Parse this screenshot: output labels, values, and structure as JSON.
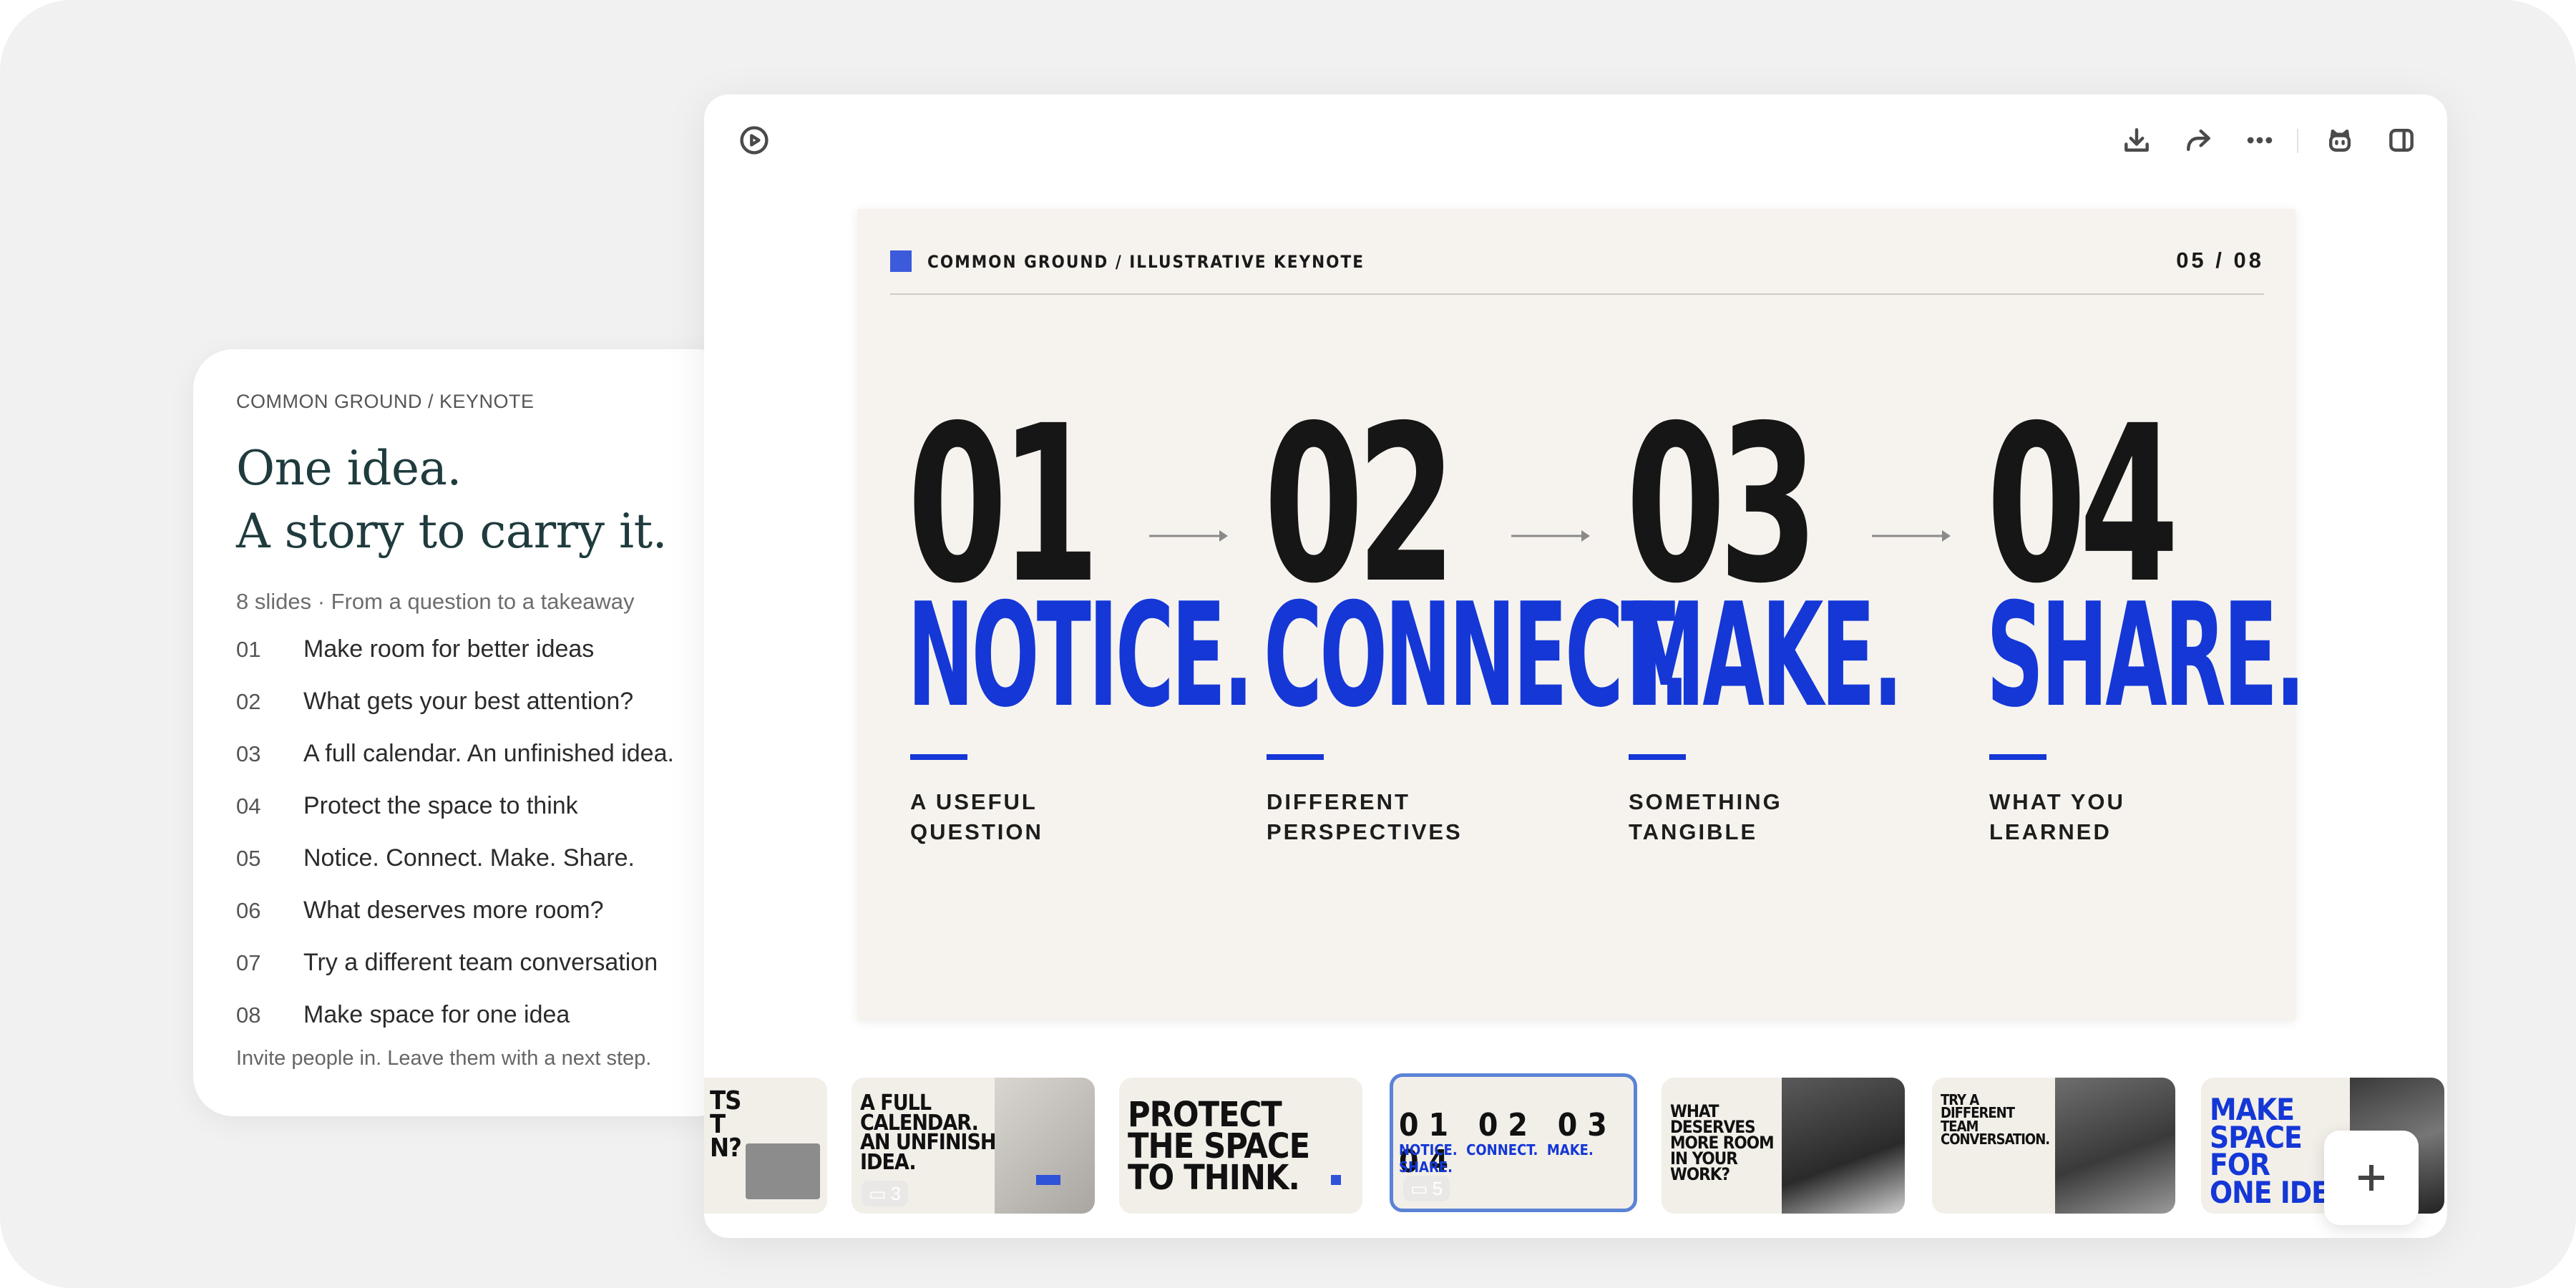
{
  "outline": {
    "kicker": "COMMON GROUND / KEYNOTE",
    "title_line1": "One idea.",
    "title_line2": "A story to carry it.",
    "meta": "8 slides · From a question to a takeaway",
    "items": [
      {
        "num": "01",
        "label": "Make room for better ideas"
      },
      {
        "num": "02",
        "label": "What gets your best attention?"
      },
      {
        "num": "03",
        "label": "A full calendar. An unfinished idea."
      },
      {
        "num": "04",
        "label": "Protect the space to think"
      },
      {
        "num": "05",
        "label": "Notice. Connect. Make. Share."
      },
      {
        "num": "06",
        "label": "What deserves more room?"
      },
      {
        "num": "07",
        "label": "Try a different team conversation"
      },
      {
        "num": "08",
        "label": "Make space for one idea"
      }
    ],
    "footer": "Invite people in. Leave them with a next step."
  },
  "toolbar": {
    "icons": [
      "play-icon",
      "download-icon",
      "share-icon",
      "more-icon",
      "assistant-icon",
      "sidebar-toggle-icon"
    ]
  },
  "slide": {
    "header": "COMMON GROUND / ILLUSTRATIVE KEYNOTE",
    "page": "05 / 08",
    "accent_color": "#1437d6",
    "steps": [
      {
        "num": "01",
        "word": "NOTICE.",
        "sub1": "A USEFUL",
        "sub2": "QUESTION"
      },
      {
        "num": "02",
        "word": "CONNECT.",
        "sub1": "DIFFERENT",
        "sub2": "PERSPECTIVES"
      },
      {
        "num": "03",
        "word": "MAKE.",
        "sub1": "SOMETHING",
        "sub2": "TANGIBLE"
      },
      {
        "num": "04",
        "word": "SHARE.",
        "sub1": "WHAT YOU",
        "sub2": "LEARNED"
      }
    ]
  },
  "filmstrip": {
    "thumbs": [
      {
        "title_l1": "TS",
        "title_l2": "T",
        "title_l3": "N?",
        "badge": ""
      },
      {
        "title_l1": "A FULL",
        "title_l2": "CALENDAR.",
        "title_l3": "AN UNFINISHED",
        "title_l4": "IDEA.",
        "badge": "3"
      },
      {
        "title_l1": "PROTECT",
        "title_l2": "THE SPACE",
        "title_l3": "TO THINK.",
        "badge": ""
      },
      {
        "title_l1": "01 02 03 04",
        "badge": "5"
      },
      {
        "title_l1": "WHAT",
        "title_l2": "DESERVES",
        "title_l3": "MORE ROOM",
        "title_l4": "IN YOUR",
        "title_l5": "WORK?",
        "badge": ""
      },
      {
        "title_l1": "TRY A",
        "title_l2": "DIFFERENT",
        "title_l3": "TEAM",
        "title_l4": "CONVERSATION.",
        "badge": ""
      },
      {
        "title_l1": "MAKE",
        "title_l2": "SPACE",
        "title_l3": "FOR",
        "title_l4": "ONE IDEA",
        "badge": ""
      }
    ]
  }
}
